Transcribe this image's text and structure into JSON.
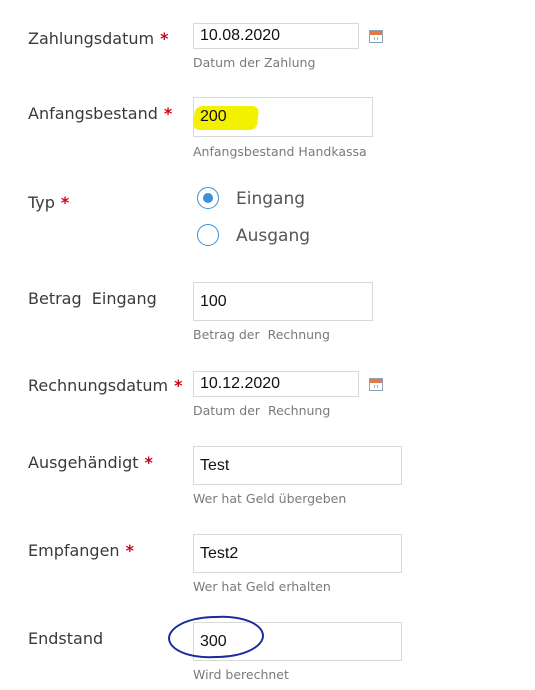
{
  "fields": {
    "zahlungsdatum": {
      "label": "Zahlungsdatum",
      "required": "*",
      "value": "10.08.2020",
      "hint": "Datum der Zahlung"
    },
    "anfangsbestand": {
      "label": "Anfangsbestand",
      "required": "*",
      "value": "200",
      "hint": "Anfangsbestand  Handkassa"
    },
    "typ": {
      "label": "Typ",
      "required": "*",
      "options": [
        {
          "label": "Eingang",
          "selected": true
        },
        {
          "label": "Ausgang",
          "selected": false
        }
      ]
    },
    "betrag_eingang": {
      "label": "Betrag  Eingang",
      "value": "100",
      "hint": "Betrag der  Rechnung"
    },
    "rechnungsdatum": {
      "label": "Rechnungsdatum",
      "required": "*",
      "value": "10.12.2020",
      "hint": "Datum der  Rechnung"
    },
    "ausgehaendigt": {
      "label": "Ausgehändigt",
      "required": "*",
      "value": "Test",
      "hint": "Wer hat Geld übergeben"
    },
    "empfangen": {
      "label": "Empfangen",
      "required": "*",
      "value": "Test2",
      "hint": "Wer hat Geld erhalten"
    },
    "endstand": {
      "label": "Endstand",
      "value": "300",
      "hint": "Wird berechnet"
    }
  },
  "icons": {
    "calendar": "calendar-icon"
  },
  "colors": {
    "required_marker": "#d0021b",
    "radio_accent": "#3a8fd6",
    "highlight_yellow": "#f4f100",
    "annotation_blue": "#1a2a9c"
  }
}
